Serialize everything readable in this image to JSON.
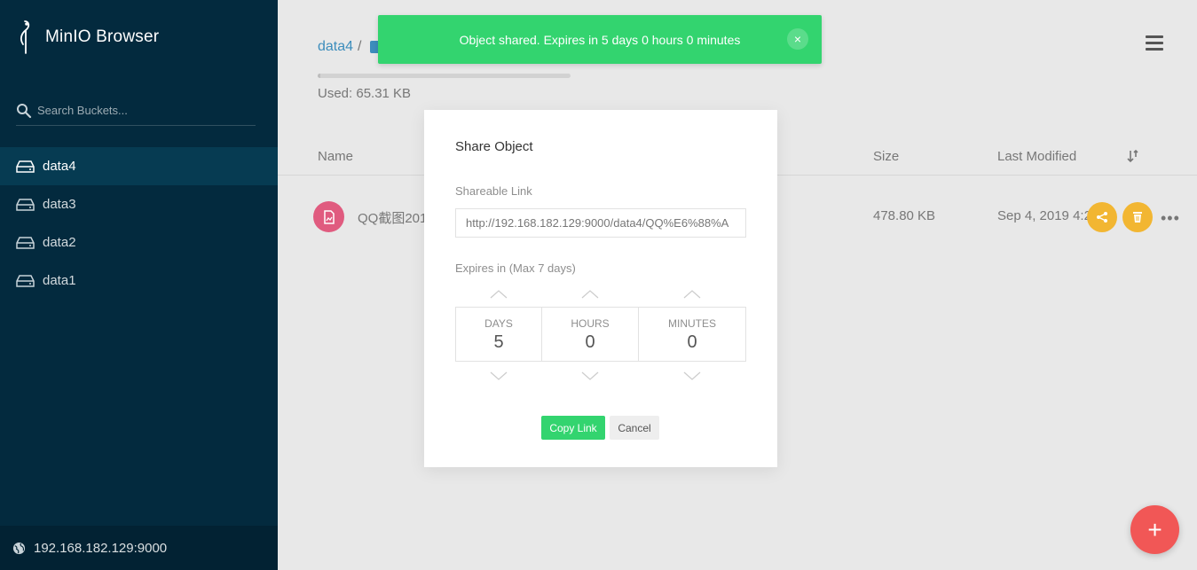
{
  "sidebar": {
    "brand": "MinIO Browser",
    "search_placeholder": "Search Buckets...",
    "buckets": [
      {
        "label": "data4",
        "active": true
      },
      {
        "label": "data3",
        "active": false
      },
      {
        "label": "data2",
        "active": false
      },
      {
        "label": "data1",
        "active": false
      }
    ],
    "host": "192.168.182.129:9000"
  },
  "header": {
    "breadcrumb_bucket": "data4",
    "breadcrumb_sep": "/",
    "used": "Used: 65.31 KB",
    "usage_fraction": 0.01
  },
  "table": {
    "columns": {
      "name": "Name",
      "size": "Size",
      "modified": "Last Modified"
    },
    "rows": [
      {
        "name": "QQ截图201",
        "size": "478.80 KB",
        "modified": "Sep 4, 2019 4:2"
      }
    ]
  },
  "toast": {
    "message": "Object shared. Expires in 5 days 0 hours 0 minutes",
    "close": "×",
    "color": "#33d46f"
  },
  "modal": {
    "title": "Share Object",
    "link_label": "Shareable Link",
    "link_value": "http://192.168.182.129:9000/data4/QQ%E6%88%A",
    "expires_label": "Expires in (Max 7 days)",
    "days_label": "DAYS",
    "days_value": "5",
    "hours_label": "HOURS",
    "hours_value": "0",
    "minutes_label": "MINUTES",
    "minutes_value": "0",
    "copy_button": "Copy Link",
    "cancel_button": "Cancel"
  },
  "fab_label": "+",
  "colors": {
    "sidebar": "#032a3e",
    "accent_green": "#33d46f",
    "action_yellow": "#f2b632",
    "fab_red": "#f15756",
    "file_icon": "#e05b7f"
  }
}
